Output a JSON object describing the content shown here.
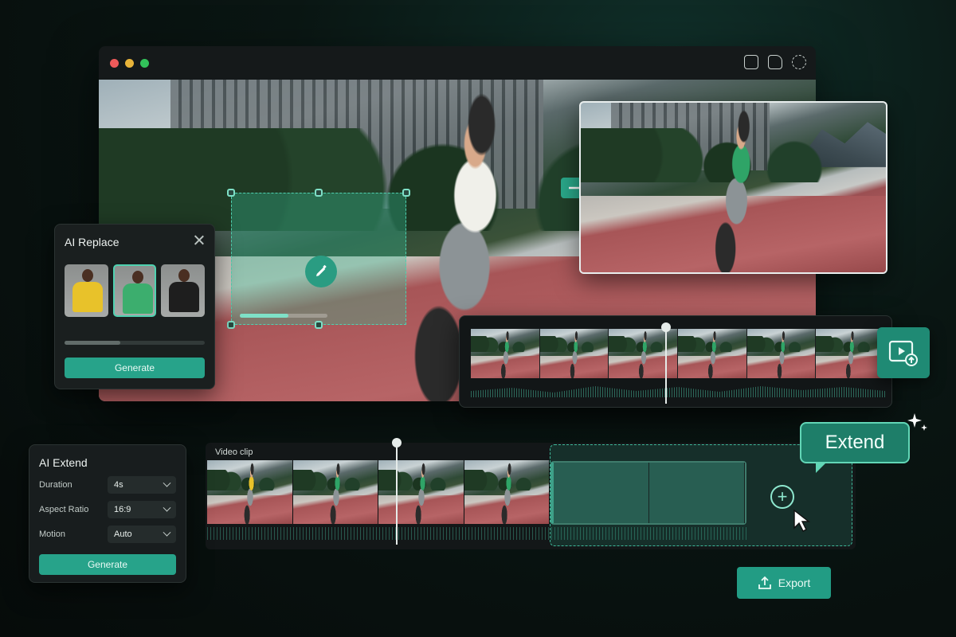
{
  "app": {
    "window_controls": [
      "close",
      "minimize",
      "maximize"
    ],
    "toolbar_icons": [
      "crop-icon",
      "sticker-icon",
      "effects-icon"
    ],
    "accent_color": "#27a38a"
  },
  "ai_replace": {
    "title": "AI Replace",
    "options": [
      {
        "name": "yellow-shirt",
        "color": "#e8c22a"
      },
      {
        "name": "green-shirt",
        "color": "#3cae6e"
      },
      {
        "name": "black-shirt",
        "color": "#1e1e1e"
      }
    ],
    "selected_index": 1,
    "progress": 0.4,
    "generate_label": "Generate"
  },
  "filmstrip": {
    "frames": 6,
    "playhead_fraction": 0.48
  },
  "timeline": {
    "track_label": "Video clip",
    "frames": 4,
    "playhead_fraction": 0.56,
    "extend_label": "Extend"
  },
  "ai_extend": {
    "title": "AI Extend",
    "fields": [
      {
        "label": "Duration",
        "value": "4s"
      },
      {
        "label": "Aspect Ratio",
        "value": "16:9"
      },
      {
        "label": "Motion",
        "value": "Auto"
      }
    ],
    "generate_label": "Generate"
  },
  "export": {
    "label": "Export"
  }
}
